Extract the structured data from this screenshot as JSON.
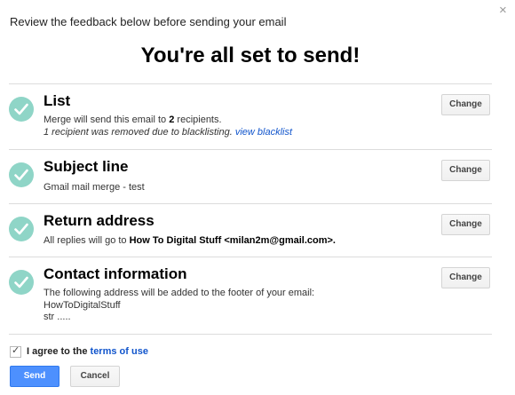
{
  "dialog": {
    "subtitle": "Review the feedback below before sending your email",
    "headline": "You're all set to send!",
    "close_glyph": "×"
  },
  "sections": [
    {
      "title": "List",
      "change_label": "Change",
      "line1_pre": "Merge will send this email to ",
      "line1_count": "2",
      "line1_post": " recipients.",
      "line2_text": "1 recipient was removed due to blacklisting. ",
      "line2_link": "view blacklist"
    },
    {
      "title": "Subject line",
      "change_label": "Change",
      "line1": "Gmail mail merge - test"
    },
    {
      "title": "Return address",
      "change_label": "Change",
      "line1_pre": "All replies will go to ",
      "line1_bold": "How To Digital Stuff <milan2m@gmail.com>."
    },
    {
      "title": "Contact information",
      "change_label": "Change",
      "lines": [
        "The following address will be added to the footer of your email:",
        "HowToDigitalStuff",
        "str ....."
      ]
    }
  ],
  "footer": {
    "agree_checked": true,
    "agree_text": "I agree to the ",
    "terms_link": "terms of use",
    "send_label": "Send",
    "cancel_label": "Cancel"
  },
  "colors": {
    "check_circle": "#8fd5c7",
    "link": "#1155cc",
    "primary_button": "#4d90fe"
  },
  "icons": {
    "close": "close-icon",
    "section_status": "checkmark-icon",
    "agree_checkbox": "checkbox-checked-icon"
  }
}
